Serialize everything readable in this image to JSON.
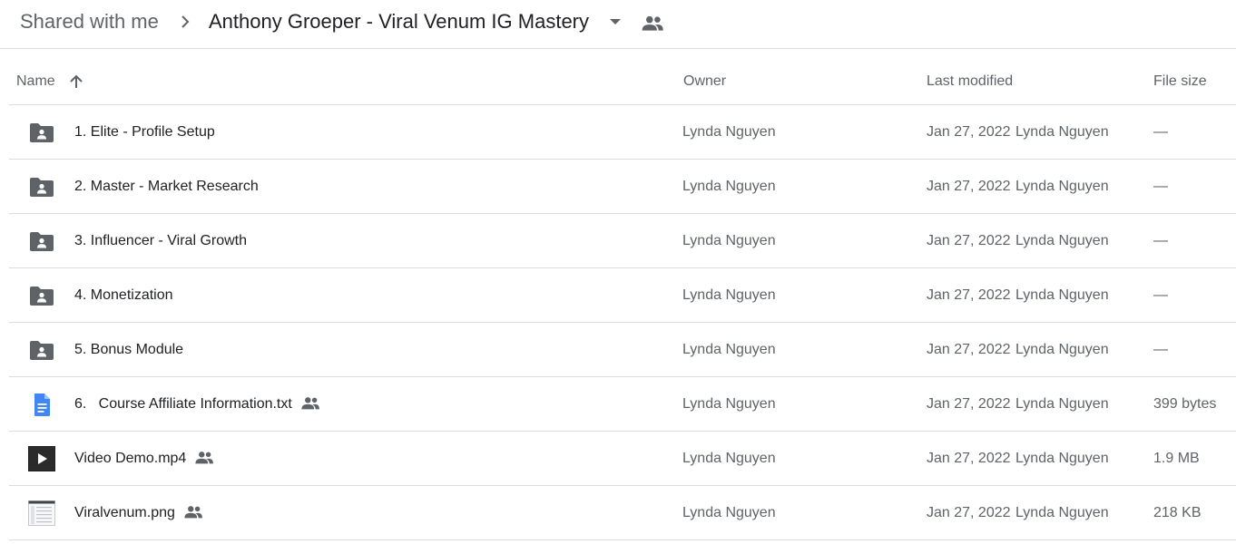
{
  "breadcrumb": {
    "root": "Shared with me",
    "current": "Anthony Groeper - Viral Venum IG Mastery"
  },
  "columns": {
    "name": "Name",
    "owner": "Owner",
    "last_modified": "Last modified",
    "file_size": "File size"
  },
  "sort": {
    "column": "Name",
    "direction": "ascending"
  },
  "files": [
    {
      "name": "1. Elite - Profile Setup",
      "type": "shared-folder",
      "shared": false,
      "owner": "Lynda Nguyen",
      "date": "Jan 27, 2022",
      "modified_by": "Lynda Nguyen",
      "size": "—"
    },
    {
      "name": "2. Master - Market Research",
      "type": "shared-folder",
      "shared": false,
      "owner": "Lynda Nguyen",
      "date": "Jan 27, 2022",
      "modified_by": "Lynda Nguyen",
      "size": "—"
    },
    {
      "name": "3. Influencer - Viral Growth",
      "type": "shared-folder",
      "shared": false,
      "owner": "Lynda Nguyen",
      "date": "Jan 27, 2022",
      "modified_by": "Lynda Nguyen",
      "size": "—"
    },
    {
      "name": "4. Monetization",
      "type": "shared-folder",
      "shared": false,
      "owner": "Lynda Nguyen",
      "date": "Jan 27, 2022",
      "modified_by": "Lynda Nguyen",
      "size": "—"
    },
    {
      "name": "5. Bonus Module",
      "type": "shared-folder",
      "shared": false,
      "owner": "Lynda Nguyen",
      "date": "Jan 27, 2022",
      "modified_by": "Lynda Nguyen",
      "size": "—"
    },
    {
      "name": "6.   Course Affiliate Information.txt",
      "type": "document",
      "shared": true,
      "owner": "Lynda Nguyen",
      "date": "Jan 27, 2022",
      "modified_by": "Lynda Nguyen",
      "size": "399 bytes"
    },
    {
      "name": "Video Demo.mp4",
      "type": "video",
      "shared": true,
      "owner": "Lynda Nguyen",
      "date": "Jan 27, 2022",
      "modified_by": "Lynda Nguyen",
      "size": "1.9 MB"
    },
    {
      "name": "Viralvenum.png",
      "type": "image",
      "shared": true,
      "owner": "Lynda Nguyen",
      "date": "Jan 27, 2022",
      "modified_by": "Lynda Nguyen",
      "size": "218 KB"
    }
  ],
  "colors": {
    "folder_icon": "#5f6368",
    "document_icon": "#4285f4",
    "divider": "#dadce0",
    "primary_text": "#202124",
    "secondary_text": "#5f6368"
  }
}
